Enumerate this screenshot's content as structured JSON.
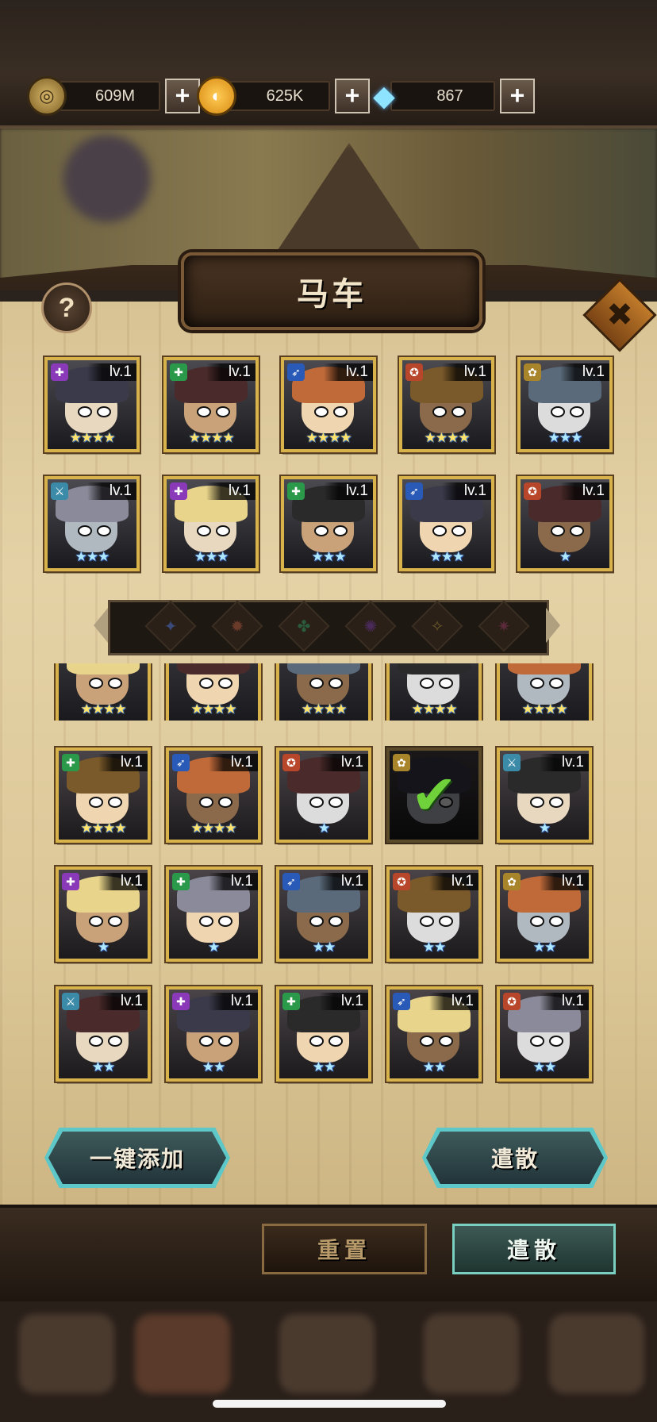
{
  "currency": [
    {
      "name": "gold-coin",
      "value": "609M",
      "icon": "coin-icon"
    },
    {
      "name": "energy",
      "value": "625K",
      "icon": "energy-orb-icon"
    },
    {
      "name": "gem",
      "value": "867",
      "icon": "diamond-icon"
    }
  ],
  "plus_label": "+",
  "panel": {
    "title": "马车",
    "help_label": "?",
    "close_label": "✖"
  },
  "lv_label": "lv.1",
  "check_label": "✔",
  "buttons": {
    "auto_add": "一键添加",
    "dismiss_top": "遣散",
    "reset": "重置",
    "dismiss": "遣散"
  }
}
